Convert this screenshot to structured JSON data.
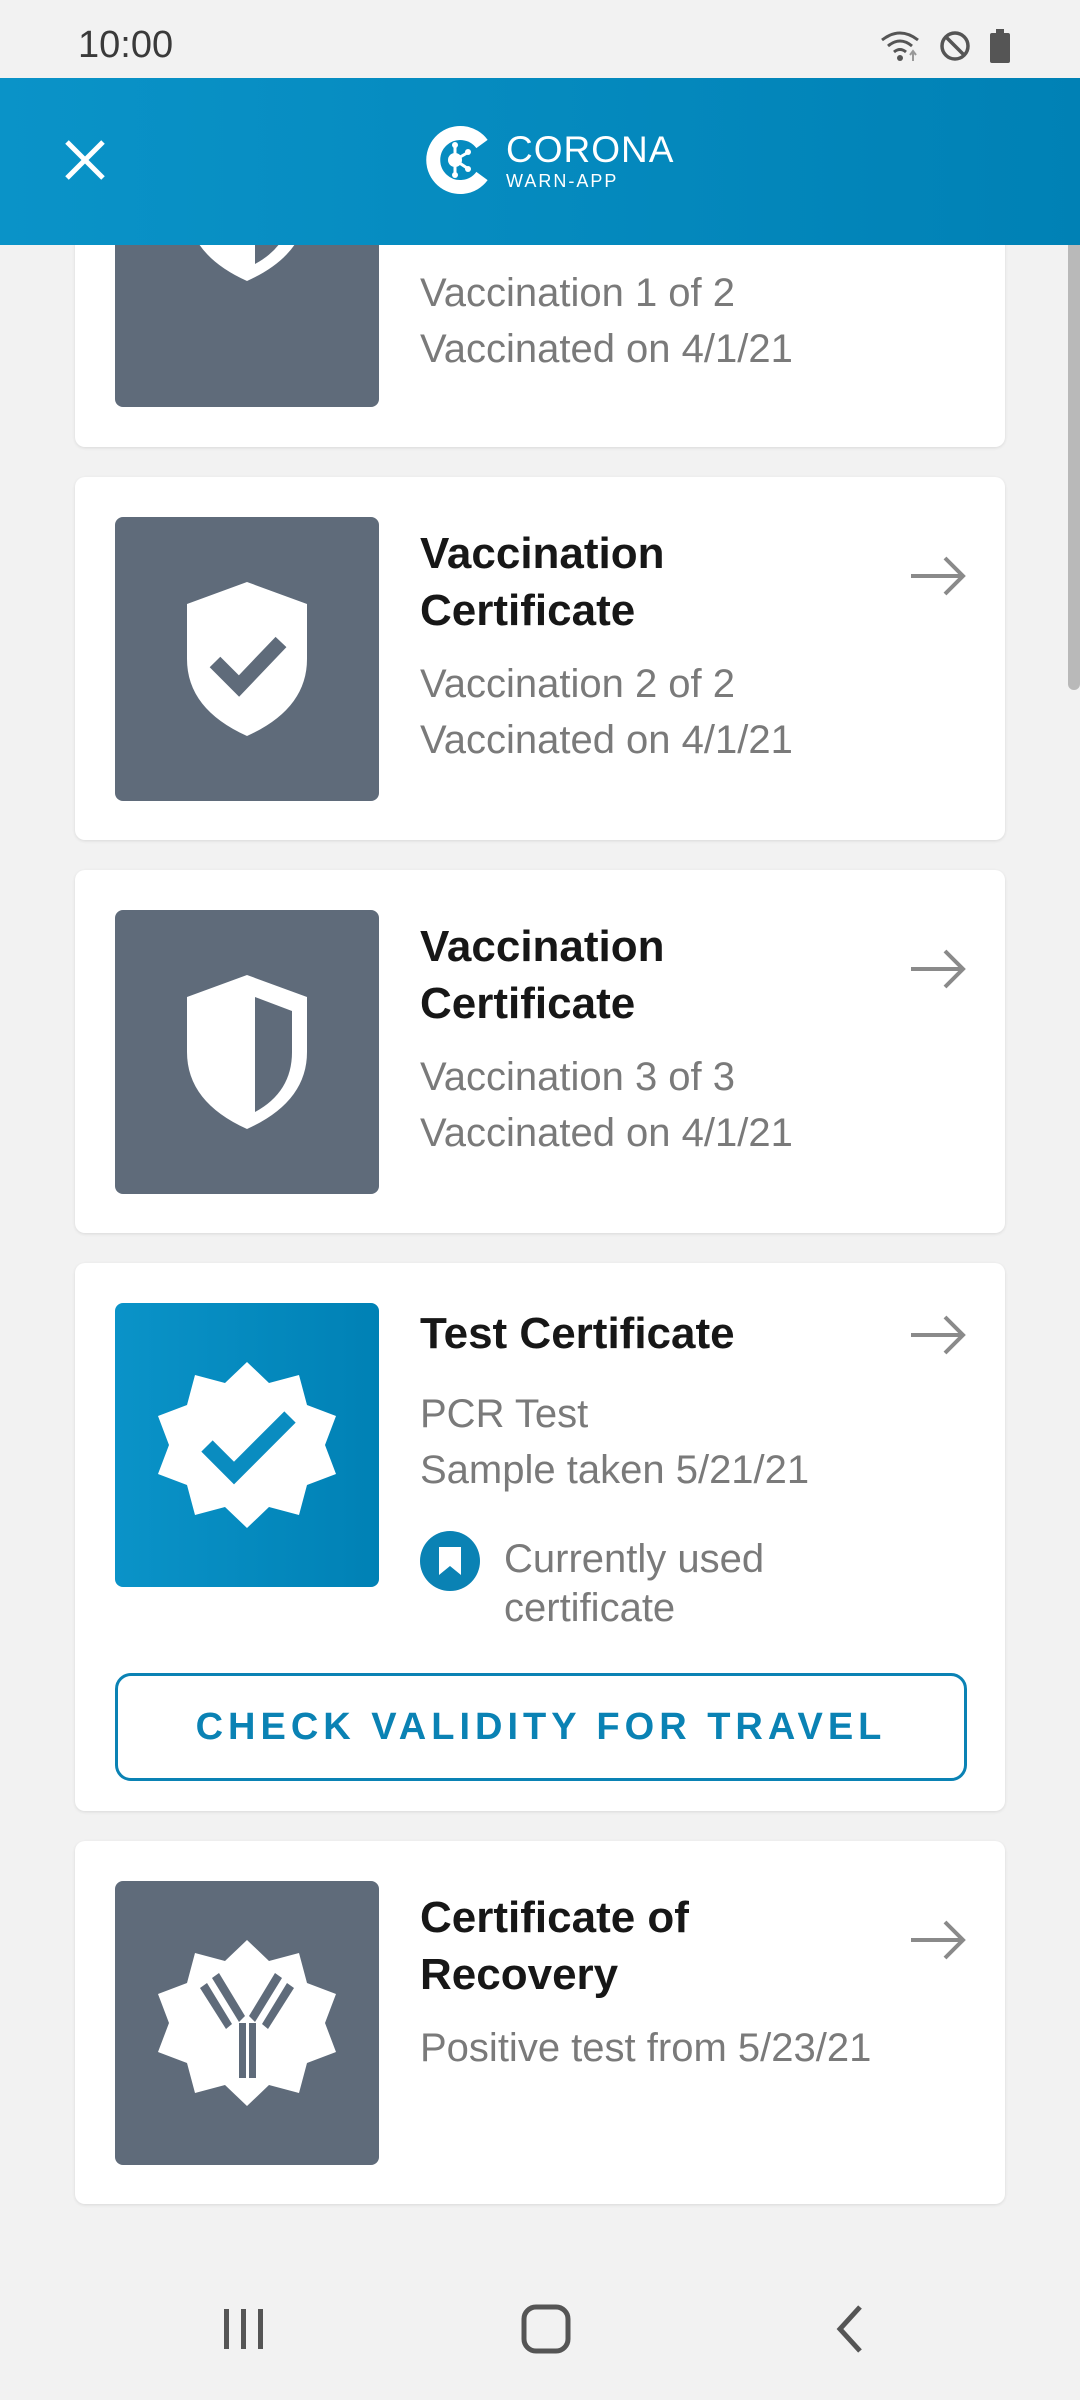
{
  "status_bar": {
    "time": "10:00",
    "icons": [
      "wifi-icon",
      "do-not-disturb-icon",
      "battery-icon"
    ]
  },
  "app_bar": {
    "close_icon": "close-icon",
    "logo": {
      "line1": "CORONA",
      "line2": "WARN-APP"
    }
  },
  "certificates": [
    {
      "title": "",
      "icon": "shield-half-icon",
      "lines": [
        "Vaccination 1 of 2",
        "Vaccinated on 4/1/21"
      ]
    },
    {
      "title": "Vaccination Certificate",
      "icon": "shield-check-icon",
      "lines": [
        "Vaccination 2 of 2",
        "Vaccinated on 4/1/21"
      ]
    },
    {
      "title": "Vaccination Certificate",
      "icon": "shield-half-icon",
      "lines": [
        "Vaccination 3 of 3",
        "Vaccinated on 4/1/21"
      ]
    },
    {
      "title": "Test Certificate",
      "icon": "badge-check-icon",
      "lines": [
        "PCR Test",
        "Sample taken 5/21/21"
      ],
      "badge_text": "Currently used certificate",
      "button_label": "CHECK VALIDITY FOR TRAVEL"
    },
    {
      "title": "Certificate of Recovery",
      "icon": "antibody-icon",
      "lines": [
        "Positive test from 5/23/21"
      ]
    }
  ],
  "nav_bar": {
    "icons": [
      "recents-icon",
      "home-icon",
      "back-icon"
    ]
  },
  "colors": {
    "brand_blue": "#0a93c8",
    "accent_blue": "#0a82b4",
    "thumb_gray": "#5f6b7a"
  }
}
